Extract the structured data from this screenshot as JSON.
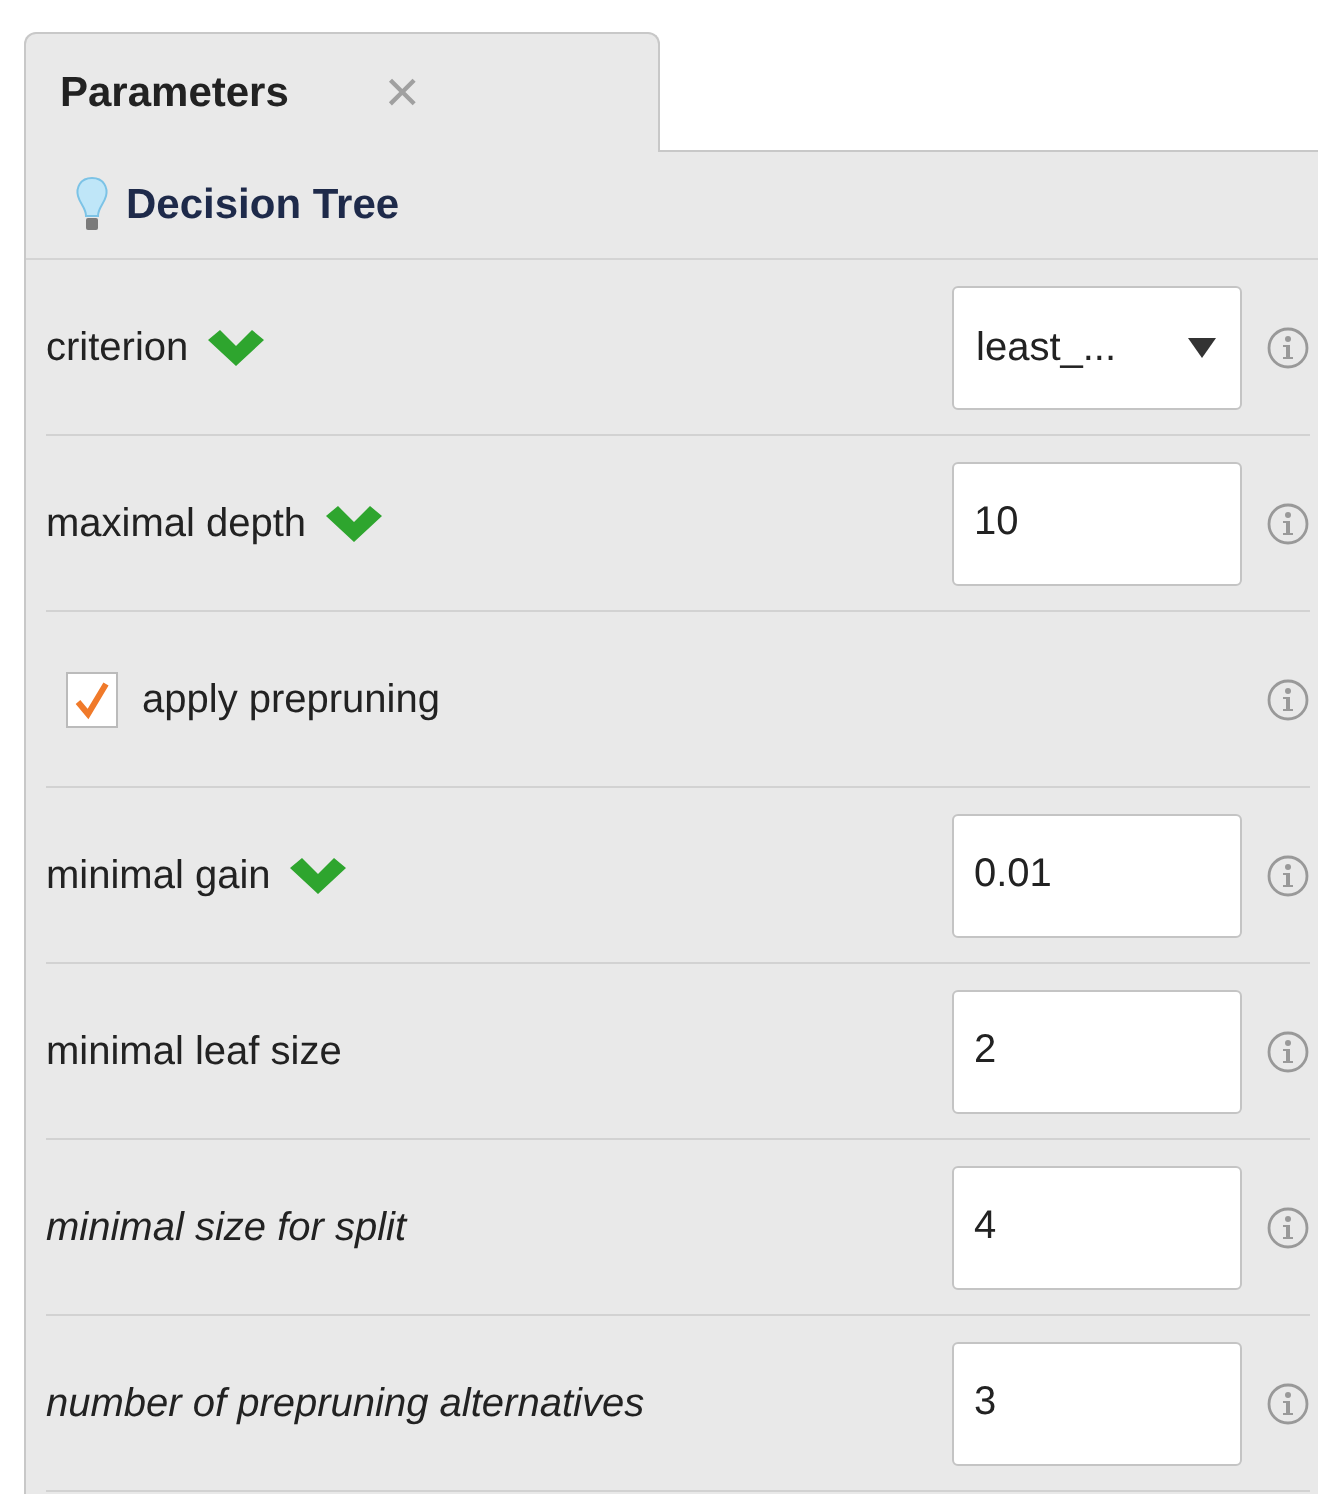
{
  "tab": {
    "title": "Parameters",
    "close": "×",
    "selected": true
  },
  "operator": {
    "name": "Decision Tree"
  },
  "parameters": [
    {
      "kind": "select",
      "label": "criterion",
      "marked": true,
      "expert": false,
      "value": "least_..."
    },
    {
      "kind": "number",
      "label": "maximal depth",
      "marked": true,
      "expert": false,
      "value": "10"
    },
    {
      "kind": "checkbox",
      "label": "apply prepruning",
      "marked": false,
      "expert": false,
      "checked": true
    },
    {
      "kind": "number",
      "label": "minimal gain",
      "marked": true,
      "expert": false,
      "value": "0.01"
    },
    {
      "kind": "number",
      "label": "minimal leaf size",
      "marked": false,
      "expert": false,
      "value": "2"
    },
    {
      "kind": "number",
      "label": "minimal size for split",
      "marked": false,
      "expert": true,
      "value": "4"
    },
    {
      "kind": "number",
      "label": "number of prepruning alternatives",
      "marked": false,
      "expert": true,
      "value": "3"
    }
  ]
}
